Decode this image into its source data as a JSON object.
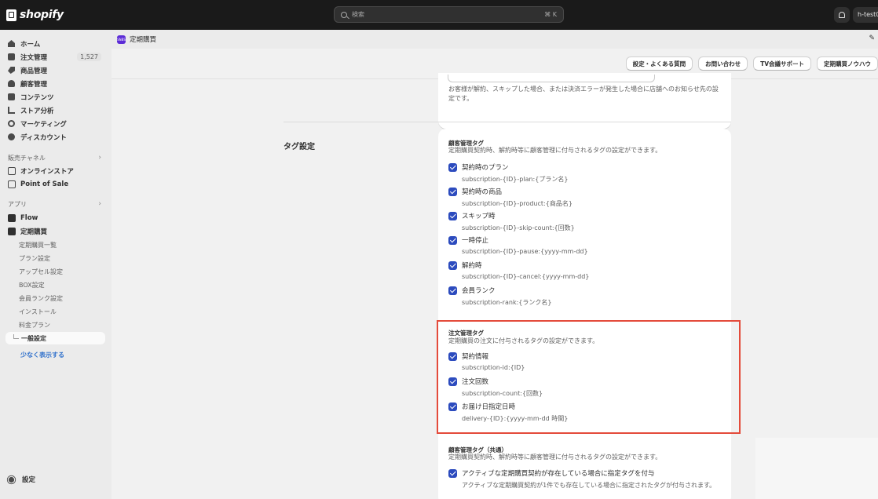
{
  "topbar": {
    "logo_text": "shopify",
    "search_placeholder": "検索",
    "search_shortcut": "⌘ K",
    "store_name": "h-test01"
  },
  "sidebar": {
    "items": [
      {
        "label": "ホーム",
        "icon": "home-icon"
      },
      {
        "label": "注文管理",
        "icon": "inbox-icon",
        "badge": "1,527"
      },
      {
        "label": "商品管理",
        "icon": "tag-icon"
      },
      {
        "label": "顧客管理",
        "icon": "person-icon"
      },
      {
        "label": "コンテンツ",
        "icon": "content-icon"
      },
      {
        "label": "ストア分析",
        "icon": "chart-icon"
      },
      {
        "label": "マーケティング",
        "icon": "target-icon"
      },
      {
        "label": "ディスカウント",
        "icon": "discount-icon"
      }
    ],
    "sales_channels_label": "販売チャネル",
    "channels": [
      {
        "label": "オンラインストア",
        "icon": "store-icon"
      },
      {
        "label": "Point of Sale",
        "icon": "pos-icon"
      }
    ],
    "apps_label": "アプリ",
    "apps": [
      {
        "label": "Flow",
        "icon": "flow-icon"
      },
      {
        "label": "定期購買",
        "icon": "subscription-app-icon"
      }
    ],
    "app_subitems": [
      "定期購買一覧",
      "プラン設定",
      "アップセル設定",
      "BOX設定",
      "会員ランク設定",
      "インストール",
      "料金プラン",
      "一般設定"
    ],
    "show_less": "少なく表示する",
    "settings_label": "設定"
  },
  "appbar": {
    "title": "定期購買",
    "icon_text": "SNBS"
  },
  "header_buttons": [
    "設定・よくある質問",
    "お問い合わせ",
    "TV会議サポート",
    "定期購買ノウハウ"
  ],
  "prev_help": "お客様が解約、スキップした場合、または決済エラーが発生した場合に店舗へのお知らせ先の設定です。",
  "section_title": "タグ設定",
  "customer_tags": {
    "title": "顧客管理タグ",
    "desc": "定期購買契約時、解約時等に顧客管理に付与されるタグの設定ができます。",
    "items": [
      {
        "label": "契約時のプラン",
        "help": "subscription-{ID}-plan:{プラン名}"
      },
      {
        "label": "契約時の商品",
        "help": "subscription-{ID}-product:{商品名}"
      },
      {
        "label": "スキップ時",
        "help": "subscription-{ID}-skip-count:{回数}"
      },
      {
        "label": "一時停止",
        "help": "subscription-{ID}-pause:{yyyy-mm-dd}"
      },
      {
        "label": "解約時",
        "help": "subscription-{ID}-cancel:{yyyy-mm-dd}"
      },
      {
        "label": "会員ランク",
        "help": "subscription-rank:{ランク名}"
      }
    ]
  },
  "order_tags": {
    "title": "注文管理タグ",
    "desc": "定期購買の注文に付与されるタグの設定ができます。",
    "items": [
      {
        "label": "契約情報",
        "help": "subscription-id:{ID}"
      },
      {
        "label": "注文回数",
        "help": "subscription-count:{回数}"
      },
      {
        "label": "お届け日指定日時",
        "help": "delivery-{ID}:{yyyy-mm-dd 時間}"
      }
    ]
  },
  "common_tags": {
    "title": "顧客管理タグ（共通）",
    "desc": "定期購買契約時、解約時等に顧客管理に付与されるタグの設定ができます。",
    "items": [
      {
        "label": "アクティブな定期購買契約が存在している場合に指定タグを付与",
        "help": "アクティブな定期購買契約が1件でも存在している場合に指定されたタグが付与されます。"
      }
    ]
  },
  "colors": {
    "accent": "#2c4bbe",
    "highlight": "#e44b3b",
    "topbar": "#1a1a1a",
    "link": "#2c6ecb"
  }
}
